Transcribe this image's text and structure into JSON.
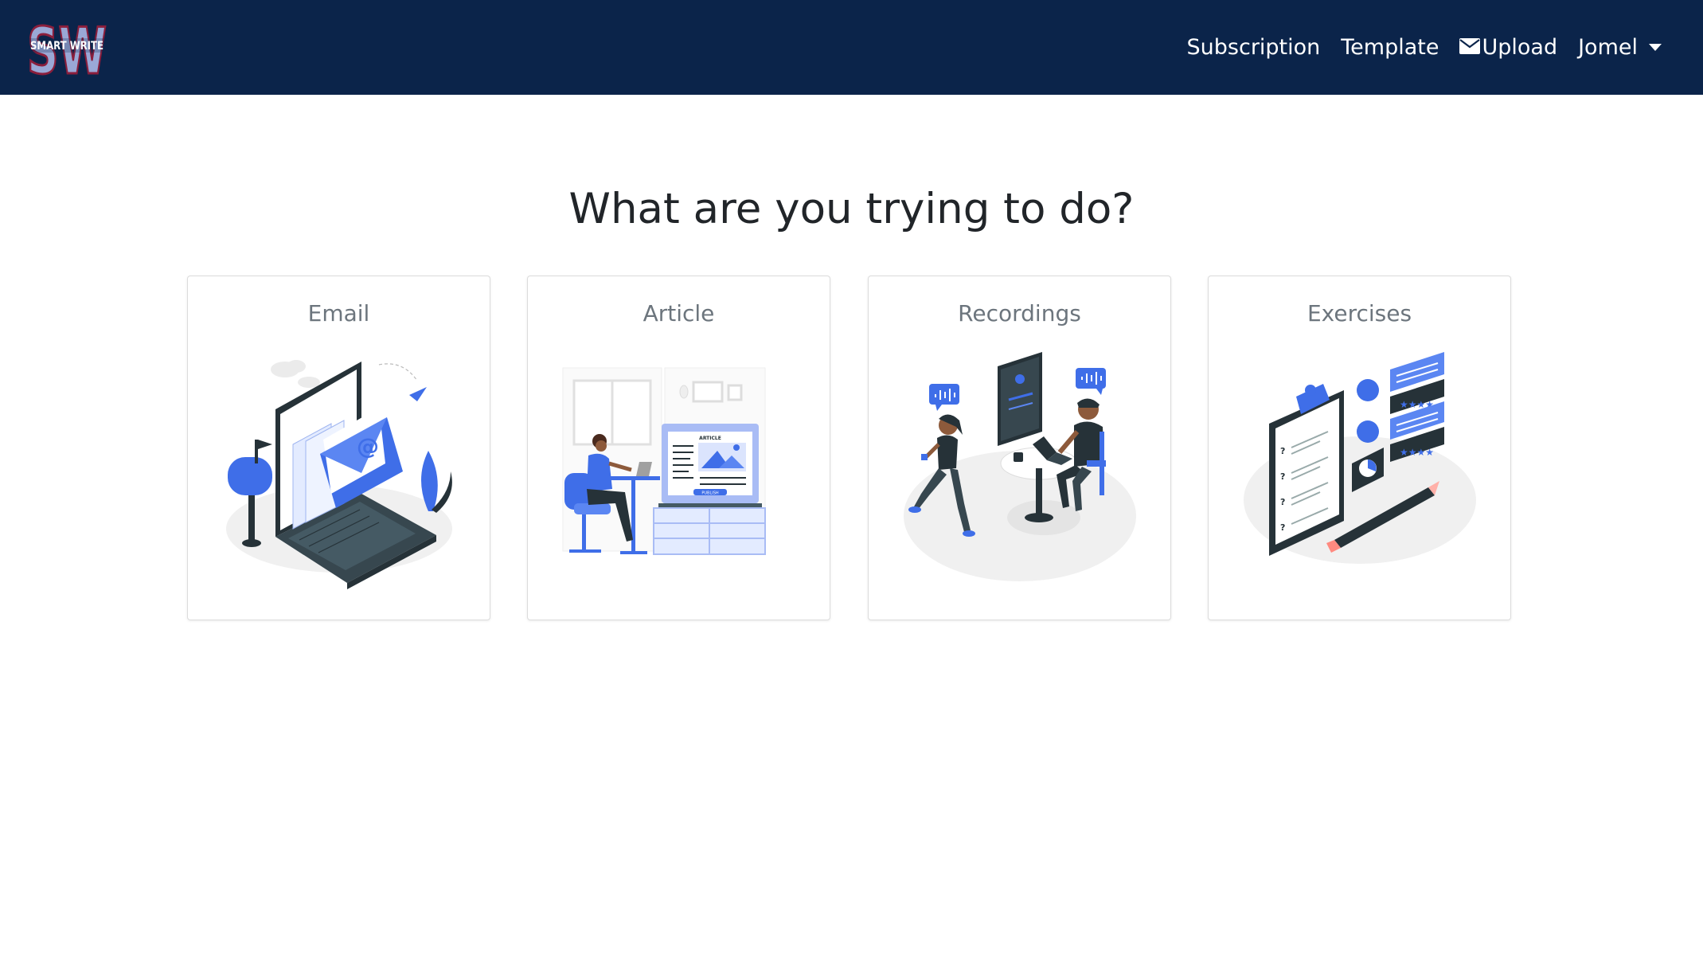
{
  "header": {
    "logo_text": "SMART WRITE",
    "logo_letters": "SW",
    "nav": {
      "subscription": "Subscription",
      "template": "Template",
      "upload": "Upload",
      "user": "Jomel"
    }
  },
  "main": {
    "title": "What are you trying to do?",
    "cards": [
      {
        "label": "Email",
        "icon": "email-illustration"
      },
      {
        "label": "Article",
        "icon": "article-illustration"
      },
      {
        "label": "Recordings",
        "icon": "recordings-illustration"
      },
      {
        "label": "Exercises",
        "icon": "exercises-illustration"
      }
    ]
  },
  "colors": {
    "navbar": "#0b244a",
    "accent": "#3f6ee8",
    "text": "#212529",
    "muted": "#6c757d"
  }
}
